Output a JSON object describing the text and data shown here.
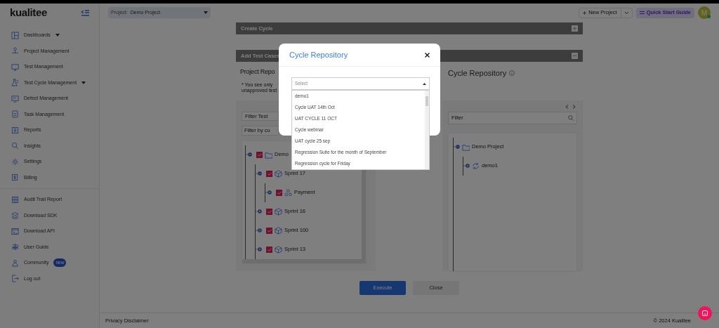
{
  "header": {
    "logo": "kualitee",
    "project_label": "Project:",
    "project_value": "Demo Project",
    "new_project": "New Project",
    "quick_start": "Quick Start Guide",
    "avatar": "M"
  },
  "sidebar": {
    "groups": [
      [
        {
          "label": "Dashboards",
          "expandable": true
        },
        {
          "label": "Project Management",
          "expandable": false
        },
        {
          "label": "Test Management",
          "expandable": false
        },
        {
          "label": "Test Cycle Management",
          "expandable": true
        },
        {
          "label": "Defect Management",
          "expandable": false
        },
        {
          "label": "Task Management",
          "expandable": false
        },
        {
          "label": "Reports",
          "expandable": false
        },
        {
          "label": "Insights",
          "expandable": false
        },
        {
          "label": "Settings",
          "expandable": false
        },
        {
          "label": "Billing",
          "expandable": false
        }
      ],
      [
        {
          "label": "Audit Trail Report",
          "expandable": false
        },
        {
          "label": "Download SDK",
          "expandable": false
        },
        {
          "label": "Download API",
          "expandable": false
        },
        {
          "label": "User Guide",
          "expandable": false
        },
        {
          "label": "Community",
          "expandable": false,
          "badge": "new"
        },
        {
          "label": "Log out",
          "expandable": false
        }
      ]
    ]
  },
  "panels": [
    {
      "title": "Create Cycle",
      "expanded": false
    },
    {
      "title": "Add Test Cases",
      "expanded": true
    }
  ],
  "project_repository": {
    "title": "Project Repo",
    "note": [
      "* You see only",
      "unapproved test"
    ],
    "filter": "Filter Test",
    "custom_filter": "Filter by cu",
    "tree": [
      {
        "label": "Demo",
        "checked": true,
        "expanded": true,
        "children": [
          {
            "label": "Sprint 17",
            "checked": true,
            "expanded": true,
            "children": [
              {
                "label": "Payment",
                "checked": true,
                "expanded": false
              }
            ]
          },
          {
            "label": "Sprint 16",
            "checked": true,
            "expanded": false
          },
          {
            "label": "Sprint 100",
            "checked": true,
            "expanded": false
          },
          {
            "label": "Sprint 13",
            "checked": true,
            "expanded": false
          }
        ]
      }
    ]
  },
  "cycle_repository": {
    "title": "Cycle Repository",
    "filter_placeholder": "Filter",
    "tree": [
      {
        "label": "Demo Project",
        "expanded": true,
        "children": [
          {
            "label": "demo1",
            "expanded": false
          }
        ]
      }
    ]
  },
  "buttons": [
    {
      "label": "Execute",
      "kind": "primary"
    },
    {
      "label": "Close",
      "kind": "secondary"
    }
  ],
  "footer": {
    "link": "Privacy Disclaimer",
    "copyright": "© 2024 Kualitee"
  },
  "modal": {
    "title": "Cycle Repository",
    "select": {
      "placeholder": "Select",
      "expanded": true,
      "options": [
        "demo1",
        "Cycle UAT 14th Oct",
        "UAT CYCLE 11 OCT",
        "Cycle webinar",
        "UAT cycle 25 sep",
        "Regression Suite for the month of September",
        "Regression cycle for Friday"
      ]
    }
  }
}
